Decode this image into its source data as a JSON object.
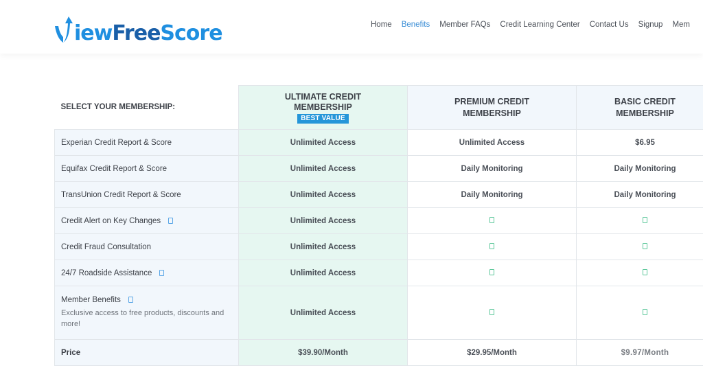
{
  "header": {
    "logo": {
      "part1": "V",
      "part2": "iew",
      "part3": "Free",
      "part4": "Score",
      "full": "ViewFreeScore"
    },
    "nav": [
      {
        "label": "Home",
        "active": false
      },
      {
        "label": "Benefits",
        "active": true
      },
      {
        "label": "Member FAQs",
        "active": false
      },
      {
        "label": "Credit Learning Center",
        "active": false
      },
      {
        "label": "Contact Us",
        "active": false
      },
      {
        "label": "Signup",
        "active": false
      },
      {
        "label": "Mem",
        "active": false
      }
    ]
  },
  "colors": {
    "brand": "#1f8fe0",
    "brand_dark": "#1a5fa8",
    "nav_active": "#3d8fd6",
    "ultimate_column": "#e6f7f1",
    "feature_column": "#f2f7fc",
    "badge": "#2596d9",
    "check": "#5cc79a"
  },
  "table": {
    "select_label": "SELECT YOUR MEMBERSHIP:",
    "plans": [
      {
        "name_line1": "ULTIMATE CREDIT",
        "name_line2": "MEMBERSHIP",
        "badge": "BEST VALUE"
      },
      {
        "name_line1": "PREMIUM CREDIT",
        "name_line2": "MEMBERSHIP"
      },
      {
        "name_line1": "BASIC CREDIT",
        "name_line2": "MEMBERSHIP"
      }
    ],
    "rows": [
      {
        "feature": "Experian Credit Report & Score",
        "info": false,
        "values": [
          "Unlimited Access",
          "Unlimited Access",
          "$6.95"
        ]
      },
      {
        "feature": "Equifax Credit Report & Score",
        "info": false,
        "values": [
          "Unlimited Access",
          "Daily Monitoring",
          "Daily Monitoring"
        ]
      },
      {
        "feature": "TransUnion Credit Report & Score",
        "info": false,
        "values": [
          "Unlimited Access",
          "Daily Monitoring",
          "Daily Monitoring"
        ]
      },
      {
        "feature": "Credit Alert on Key Changes",
        "info": true,
        "values": [
          "Unlimited Access",
          "check",
          "check"
        ]
      },
      {
        "feature": "Credit Fraud Consultation",
        "info": false,
        "values": [
          "Unlimited Access",
          "check",
          "check"
        ]
      },
      {
        "feature": "24/7 Roadside Assistance",
        "info": true,
        "values": [
          "Unlimited Access",
          "check",
          "check"
        ]
      },
      {
        "feature": "Member Benefits",
        "info": true,
        "description": "Exclusive access to free products, discounts and more!",
        "values": [
          "Unlimited Access",
          "check",
          "check"
        ]
      }
    ],
    "price": {
      "label": "Price",
      "values": [
        "$39.90/Month",
        "$29.95/Month",
        "$9.97/Month"
      ]
    }
  }
}
